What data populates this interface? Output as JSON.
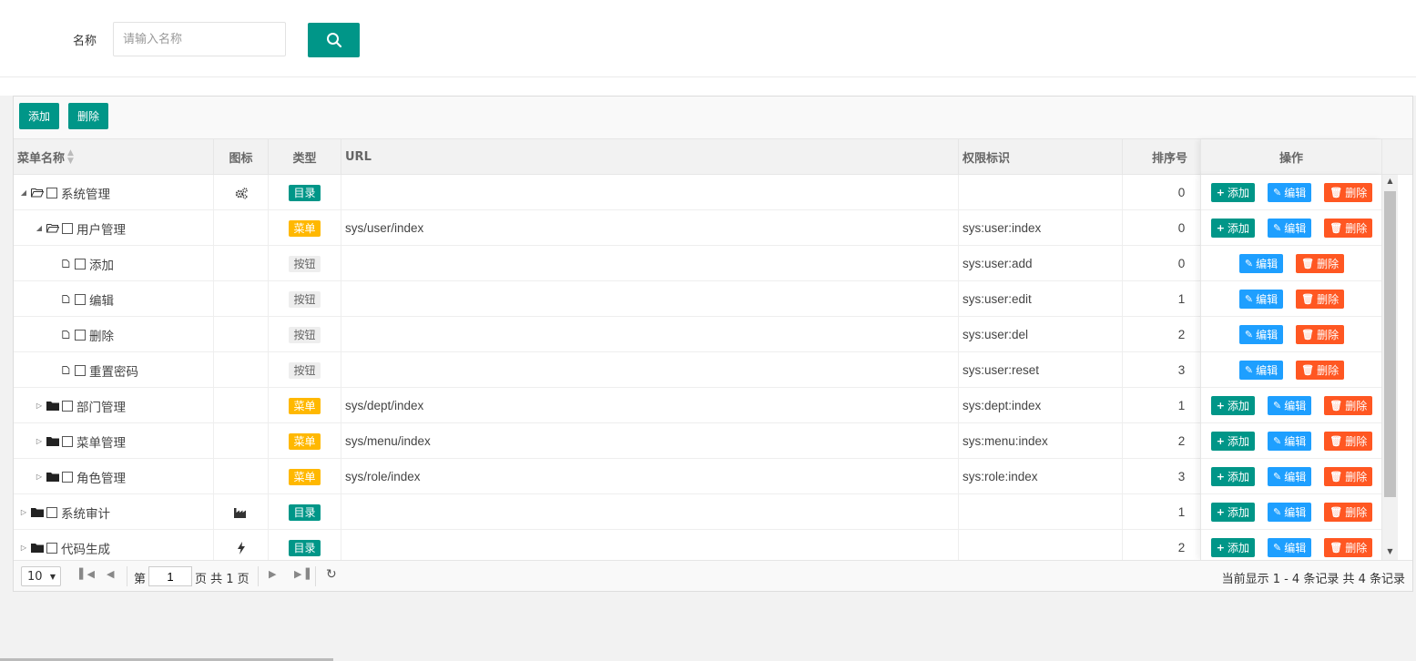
{
  "search": {
    "label": "名称",
    "placeholder": "请输入名称"
  },
  "toolbar": {
    "add_label": "添加",
    "delete_label": "删除"
  },
  "columns": {
    "name": "菜单名称",
    "icon": "图标",
    "type": "类型",
    "url": "URL",
    "perm": "权限标识",
    "order": "排序号",
    "ops": "操作"
  },
  "ops_labels": {
    "add": "添加",
    "edit": "编辑",
    "delete": "删除"
  },
  "rows": [
    {
      "name": "系统管理",
      "level": 0,
      "expand": "open",
      "node": "folder-open",
      "icon": "gears-icon",
      "type": "目录",
      "type_kind": "dir",
      "url": "",
      "perm": "",
      "order": "0",
      "ops": [
        "add",
        "edit",
        "delete"
      ]
    },
    {
      "name": "用户管理",
      "level": 1,
      "expand": "open",
      "node": "folder-open",
      "icon": "",
      "type": "菜单",
      "type_kind": "menu",
      "url": "sys/user/index",
      "perm": "sys:user:index",
      "order": "0",
      "ops": [
        "add",
        "edit",
        "delete"
      ]
    },
    {
      "name": "添加",
      "level": 2,
      "expand": "none",
      "node": "file",
      "icon": "",
      "type": "按钮",
      "type_kind": "btn",
      "url": "",
      "perm": "sys:user:add",
      "order": "0",
      "ops": [
        "edit",
        "delete"
      ]
    },
    {
      "name": "编辑",
      "level": 2,
      "expand": "none",
      "node": "file",
      "icon": "",
      "type": "按钮",
      "type_kind": "btn",
      "url": "",
      "perm": "sys:user:edit",
      "order": "1",
      "ops": [
        "edit",
        "delete"
      ]
    },
    {
      "name": "删除",
      "level": 2,
      "expand": "none",
      "node": "file",
      "icon": "",
      "type": "按钮",
      "type_kind": "btn",
      "url": "",
      "perm": "sys:user:del",
      "order": "2",
      "ops": [
        "edit",
        "delete"
      ]
    },
    {
      "name": "重置密码",
      "level": 2,
      "expand": "none",
      "node": "file",
      "icon": "",
      "type": "按钮",
      "type_kind": "btn",
      "url": "",
      "perm": "sys:user:reset",
      "order": "3",
      "ops": [
        "edit",
        "delete"
      ]
    },
    {
      "name": "部门管理",
      "level": 1,
      "expand": "closed",
      "node": "folder",
      "icon": "",
      "type": "菜单",
      "type_kind": "menu",
      "url": "sys/dept/index",
      "perm": "sys:dept:index",
      "order": "1",
      "ops": [
        "add",
        "edit",
        "delete"
      ]
    },
    {
      "name": "菜单管理",
      "level": 1,
      "expand": "closed",
      "node": "folder",
      "icon": "",
      "type": "菜单",
      "type_kind": "menu",
      "url": "sys/menu/index",
      "perm": "sys:menu:index",
      "order": "2",
      "ops": [
        "add",
        "edit",
        "delete"
      ]
    },
    {
      "name": "角色管理",
      "level": 1,
      "expand": "closed",
      "node": "folder",
      "icon": "",
      "type": "菜单",
      "type_kind": "menu",
      "url": "sys/role/index",
      "perm": "sys:role:index",
      "order": "3",
      "ops": [
        "add",
        "edit",
        "delete"
      ]
    },
    {
      "name": "系统审计",
      "level": 0,
      "expand": "closed",
      "node": "folder",
      "icon": "industry-icon",
      "type": "目录",
      "type_kind": "dir",
      "url": "",
      "perm": "",
      "order": "1",
      "ops": [
        "add",
        "edit",
        "delete"
      ]
    },
    {
      "name": "代码生成",
      "level": 0,
      "expand": "closed",
      "node": "folder",
      "icon": "bolt-icon",
      "type": "目录",
      "type_kind": "dir",
      "url": "",
      "perm": "",
      "order": "2",
      "ops": [
        "add",
        "edit",
        "delete"
      ]
    }
  ],
  "pager": {
    "page_size": "10",
    "page_prefix": "第",
    "current_page": "1",
    "page_suffix": "页 共 1 页",
    "info": "当前显示 1 - 4 条记录 共 4 条记录"
  },
  "colors": {
    "primary": "#009688",
    "edit": "#1e9fff",
    "danger": "#ff5722",
    "warn": "#ffb800"
  }
}
